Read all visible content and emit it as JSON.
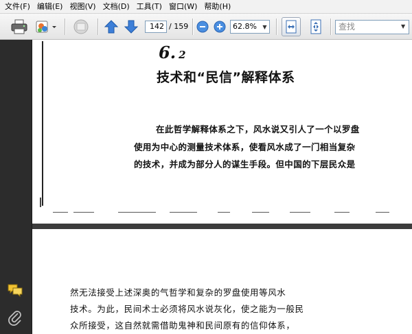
{
  "menubar": {
    "items": [
      "文件(F)",
      "编辑(E)",
      "视图(V)",
      "文档(D)",
      "工具(T)",
      "窗口(W)",
      "帮助(H)"
    ]
  },
  "toolbar": {
    "icons": [
      "printer-icon",
      "collaborate-icon",
      "review-icon",
      "previous-page-icon",
      "next-page-icon",
      "zoom-out-icon",
      "zoom-in-icon",
      "fit-width-icon",
      "fit-page-icon"
    ],
    "current_page": "142",
    "total_pages": "/ 159",
    "zoom": "62.8%",
    "search_placeholder": "查找",
    "colors": {
      "accent_blue": "#2f6fc9",
      "arrow_blue": "#3d7fd8"
    }
  },
  "navpane": {
    "icons": [
      "comments-icon",
      "attachments-icon"
    ]
  },
  "document": {
    "page1": {
      "section_number": "6.",
      "section_sub": "2",
      "section_title": "技术和“民信”解释体系",
      "lines": [
        "在此哲学解释体系之下，风水说又引人了一个以罗盘",
        "使用为中心的测量技术体系，使看风水成了一门相当复杂",
        "的技术，并成为部分人的谋生手段。但中国的下层民众是"
      ]
    },
    "page2": {
      "lines": [
        "然无法接受上述深奥的气哲学和复杂的罗盘使用等风水",
        "技术。为此，民间术士必须将风水说灰化，使之能为一般民",
        "众所接受，这自然就需借助鬼神和民间原有的信仰体系，"
      ]
    }
  }
}
